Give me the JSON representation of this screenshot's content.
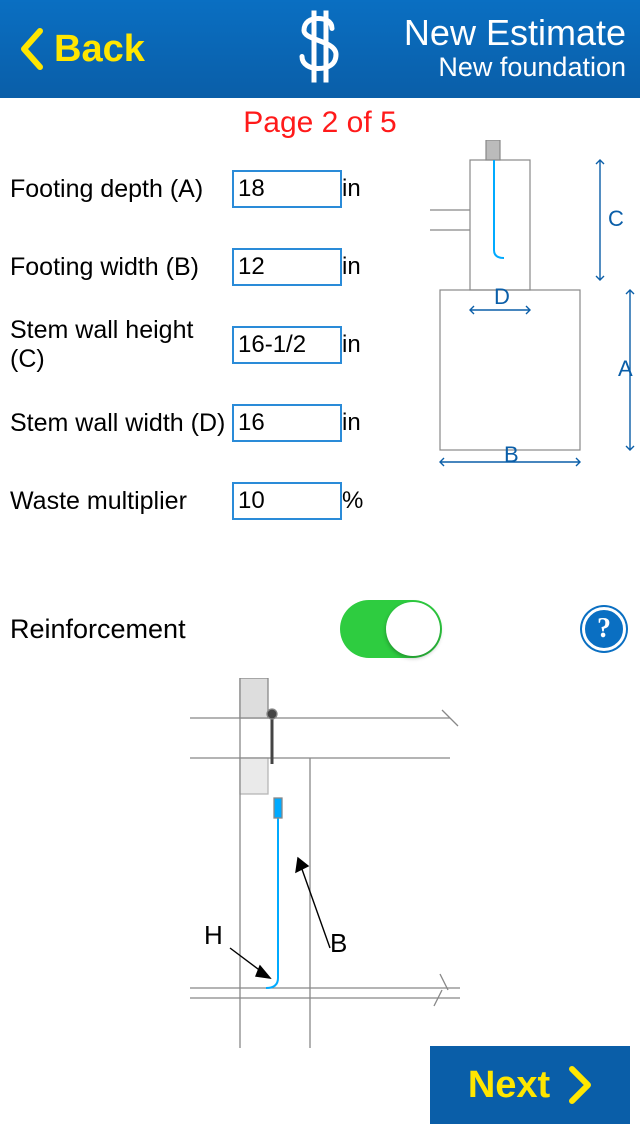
{
  "header": {
    "back_label": "Back",
    "title": "New Estimate",
    "subtitle": "New foundation"
  },
  "page_indicator": "Page 2 of 5",
  "fields": [
    {
      "label": "Footing depth (A)",
      "value": "18",
      "unit": "in"
    },
    {
      "label": "Footing width (B)",
      "value": "12",
      "unit": "in"
    },
    {
      "label": "Stem wall height (C)",
      "value": "16-1/2",
      "unit": "in"
    },
    {
      "label": "Stem wall width (D)",
      "value": "16",
      "unit": "in"
    },
    {
      "label": "Waste multiplier",
      "value": "10",
      "unit": "%"
    }
  ],
  "reinforcement": {
    "label": "Reinforcement",
    "enabled": true
  },
  "diagram_small": {
    "labels": [
      "A",
      "B",
      "C",
      "D"
    ]
  },
  "diagram_large": {
    "labels": [
      "H",
      "B"
    ]
  },
  "help_icon": "?",
  "next_label": "Next"
}
